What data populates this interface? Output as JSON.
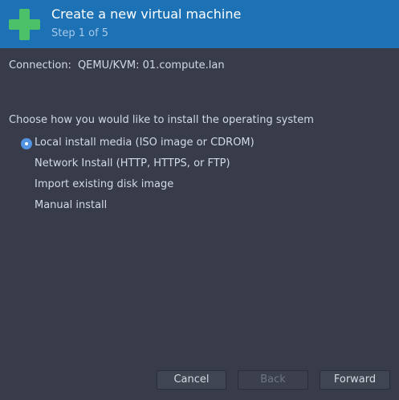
{
  "header": {
    "title": "Create a new virtual machine",
    "subtitle": "Step 1 of 5",
    "icon": "plus-icon",
    "background_color": "#1c72b5",
    "icon_color": "#4cc16a"
  },
  "connection": {
    "label": "Connection:",
    "value": "QEMU/KVM: 01.compute.lan"
  },
  "install": {
    "prompt": "Choose how you would like to install the operating system",
    "options": [
      {
        "label": "Local install media (ISO image or CDROM)",
        "selected": true
      },
      {
        "label": "Network Install (HTTP, HTTPS, or FTP)",
        "selected": false
      },
      {
        "label": "Import existing disk image",
        "selected": false
      },
      {
        "label": "Manual install",
        "selected": false
      }
    ]
  },
  "buttons": {
    "cancel": "Cancel",
    "back": "Back",
    "forward": "Forward",
    "back_enabled": false
  },
  "colors": {
    "background": "#383c4a",
    "accent": "#5294e2",
    "text": "#d3dae3"
  }
}
